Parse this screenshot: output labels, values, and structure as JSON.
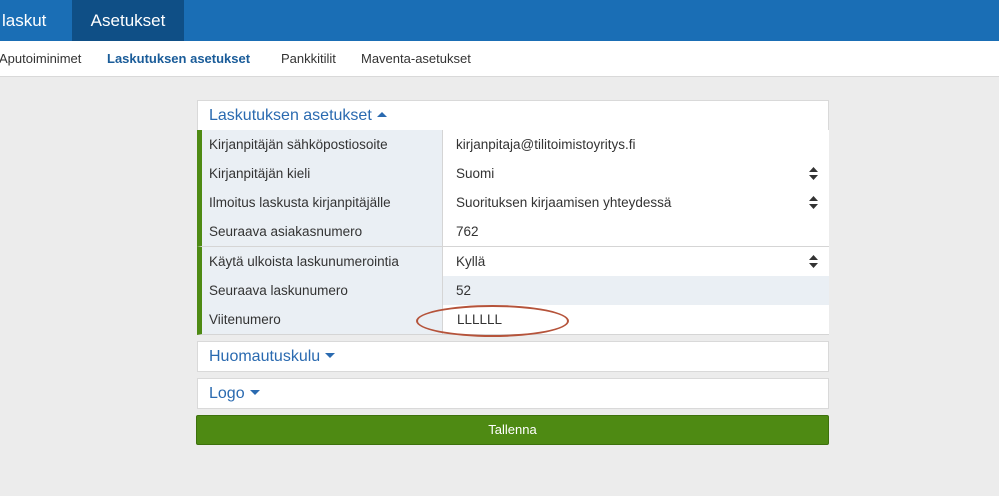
{
  "topnav": {
    "items": [
      {
        "label": "laskut"
      },
      {
        "label": "Asetukset",
        "active": true
      }
    ]
  },
  "subnav": {
    "items": [
      {
        "label": "Aputoiminimet"
      },
      {
        "label": "Laskutuksen asetukset",
        "active": true
      },
      {
        "label": "Pankkitilit"
      },
      {
        "label": "Maventa-asetukset"
      }
    ]
  },
  "settings": {
    "title": "Laskutuksen asetukset",
    "rows": [
      {
        "label": "Kirjanpitäjän sähköpostiosoite",
        "value": "kirjanpitaja@tilitoimistoyritys.fi",
        "kind": "text"
      },
      {
        "label": "Kirjanpitäjän kieli",
        "value": "Suomi",
        "kind": "select"
      },
      {
        "label": "Ilmoitus laskusta kirjanpitäjälle",
        "value": "Suorituksen kirjaamisen yhteydessä",
        "kind": "select"
      },
      {
        "label": "Seuraava asiakasnumero",
        "value": "762",
        "kind": "text"
      },
      {
        "label": "Käytä ulkoista laskunumerointia",
        "value": "Kyllä",
        "kind": "select"
      },
      {
        "label": "Seuraava laskunumero",
        "value": "52",
        "kind": "readonly"
      },
      {
        "label": "Viitenumero",
        "value": "LLLLLL",
        "kind": "text"
      }
    ]
  },
  "sections": {
    "reminder_fee": "Huomautuskulu",
    "logo": "Logo"
  },
  "actions": {
    "save_label": "Tallenna"
  },
  "colors": {
    "topbar": "#1a6eb5",
    "topbar_active": "#0f4f86",
    "accent_green": "#4e8a13",
    "link_blue": "#2a6ab0",
    "highlight": "#b5533a"
  }
}
